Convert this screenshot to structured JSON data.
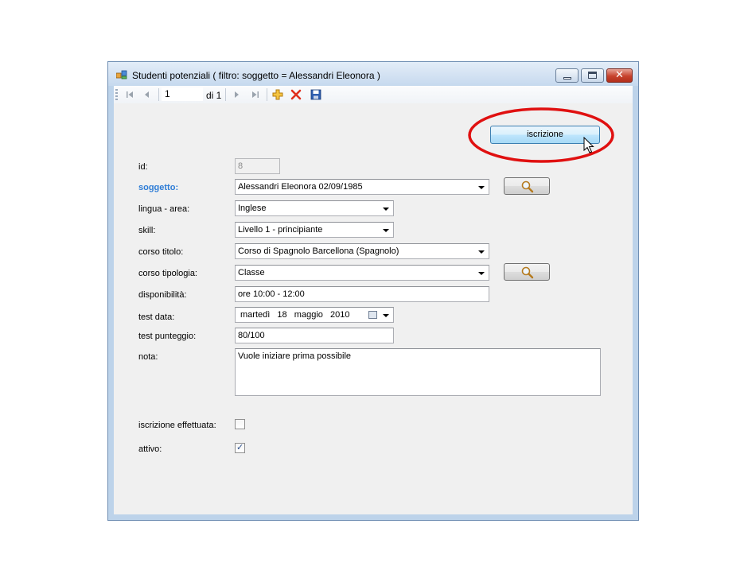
{
  "window": {
    "title": "Studenti potenziali ( filtro: soggetto = Alessandri Eleonora )",
    "controls": {
      "close_glyph": "✕"
    }
  },
  "toolbar": {
    "position": "1",
    "count_label": "di 1",
    "icons": [
      "move-first-icon",
      "move-previous-icon",
      "move-next-icon",
      "move-last-icon",
      "add-icon",
      "delete-icon",
      "save-icon"
    ]
  },
  "actions": {
    "iscrizione_label": "iscrizione"
  },
  "form": {
    "id": {
      "label": "id:",
      "value": "8"
    },
    "soggetto": {
      "label": "soggetto:",
      "value": "Alessandri Eleonora 02/09/1985"
    },
    "lingua_area": {
      "label": "lingua - area:",
      "value": "Inglese"
    },
    "skill": {
      "label": "skill:",
      "value": "Livello 1 - principiante"
    },
    "corso_titolo": {
      "label": "corso titolo:",
      "value": "Corso di Spagnolo Barcellona (Spagnolo)"
    },
    "corso_tipologia": {
      "label": "corso tipologia:",
      "value": "Classe"
    },
    "disponibilita": {
      "label": "disponibilità:",
      "value": "ore 10:00 - 12:00"
    },
    "test_data": {
      "label": "test data:",
      "weekday": "martedì",
      "day": "18",
      "month": "maggio",
      "year": "2010"
    },
    "test_punteggio": {
      "label": "test punteggio:",
      "value": "80/100"
    },
    "nota": {
      "label": "nota:",
      "value": "Vuole iniziare prima possibile"
    },
    "iscrizione_effettuata": {
      "label": "iscrizione effettuata:",
      "checked": false
    },
    "attivo": {
      "label": "attivo:",
      "checked": true,
      "check_glyph": "✓"
    }
  },
  "colors": {
    "title_bg": "#c6d9ee",
    "accent_label": "#2d7cd6",
    "annotation_circle": "#e01010",
    "close_button": "#c7422d"
  }
}
